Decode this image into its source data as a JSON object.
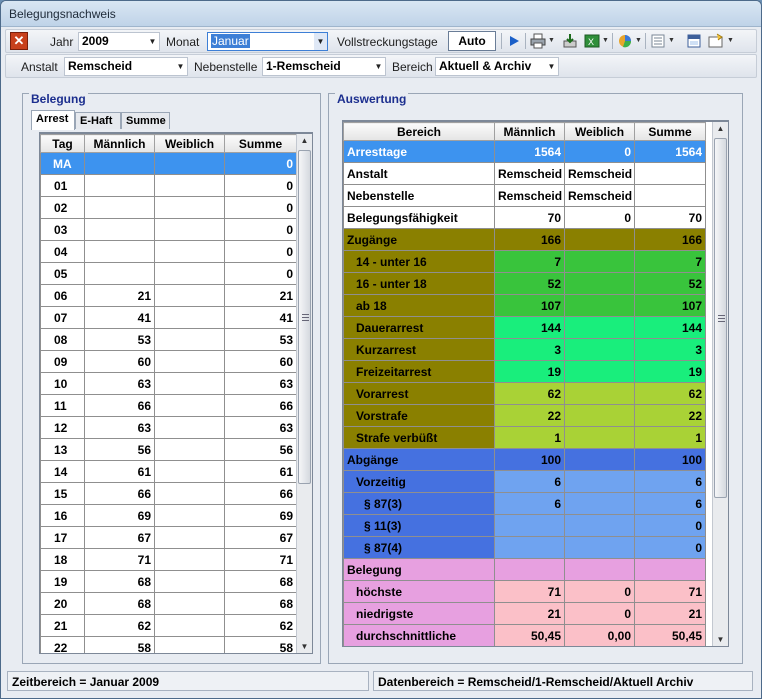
{
  "window": {
    "title": "Belegungsnachweis"
  },
  "toolbar": {
    "jahr_label": "Jahr",
    "jahr_value": "2009",
    "monat_label": "Monat",
    "monat_value": "Januar",
    "vollstreckung_label": "Vollstreckungstage",
    "auto_label": "Auto",
    "anstalt_label": "Anstalt",
    "anstalt_value": "Remscheid",
    "nebenstelle_label": "Nebenstelle",
    "nebenstelle_value": "1-Remscheid",
    "bereich_label": "Bereich",
    "bereich_value": "Aktuell & Archiv"
  },
  "icons": [
    "close-icon",
    "play-icon",
    "print-icon",
    "export-icon",
    "excel-icon",
    "chart-icon",
    "list-icon",
    "preview-icon",
    "settings-icon"
  ],
  "belegung": {
    "title": "Belegung",
    "tabs": [
      "Arrest",
      "E-Haft",
      "Summe"
    ],
    "columns": [
      "Tag",
      "Männlich",
      "Weiblich",
      "Summe"
    ],
    "rows": [
      [
        "MA",
        "",
        "",
        "0"
      ],
      [
        "01",
        "",
        "",
        "0"
      ],
      [
        "02",
        "",
        "",
        "0"
      ],
      [
        "03",
        "",
        "",
        "0"
      ],
      [
        "04",
        "",
        "",
        "0"
      ],
      [
        "05",
        "",
        "",
        "0"
      ],
      [
        "06",
        "21",
        "",
        "21"
      ],
      [
        "07",
        "41",
        "",
        "41"
      ],
      [
        "08",
        "53",
        "",
        "53"
      ],
      [
        "09",
        "60",
        "",
        "60"
      ],
      [
        "10",
        "63",
        "",
        "63"
      ],
      [
        "11",
        "66",
        "",
        "66"
      ],
      [
        "12",
        "63",
        "",
        "63"
      ],
      [
        "13",
        "56",
        "",
        "56"
      ],
      [
        "14",
        "61",
        "",
        "61"
      ],
      [
        "15",
        "66",
        "",
        "66"
      ],
      [
        "16",
        "69",
        "",
        "69"
      ],
      [
        "17",
        "67",
        "",
        "67"
      ],
      [
        "18",
        "71",
        "",
        "71"
      ],
      [
        "19",
        "68",
        "",
        "68"
      ],
      [
        "20",
        "68",
        "",
        "68"
      ],
      [
        "21",
        "62",
        "",
        "62"
      ],
      [
        "22",
        "58",
        "",
        "58"
      ]
    ]
  },
  "auswertung": {
    "title": "Auswertung",
    "columns": [
      "Bereich",
      "Männlich",
      "Weiblich",
      "Summe"
    ],
    "rows": [
      {
        "style": "hl",
        "indent": 0,
        "cells": [
          "Arresttage",
          "1564",
          "0",
          "1564"
        ]
      },
      {
        "style": "white",
        "indent": 0,
        "cells": [
          "Anstalt",
          "Remscheid",
          "Remscheid",
          ""
        ]
      },
      {
        "style": "white",
        "indent": 0,
        "cells": [
          "Nebenstelle",
          "Remscheid",
          "Remscheid",
          ""
        ]
      },
      {
        "style": "white",
        "indent": 0,
        "cells": [
          "Belegungsfähigkeit",
          "70",
          "0",
          "70"
        ]
      },
      {
        "style": "olive",
        "indent": 0,
        "cells": [
          "Zugänge",
          "166",
          "",
          "166"
        ]
      },
      {
        "style": "g1",
        "indent": 1,
        "cells": [
          "14 - unter 16",
          "7",
          "",
          "7"
        ]
      },
      {
        "style": "g1",
        "indent": 1,
        "cells": [
          "16 - unter 18",
          "52",
          "",
          "52"
        ]
      },
      {
        "style": "g1",
        "indent": 1,
        "cells": [
          "ab 18",
          "107",
          "",
          "107"
        ]
      },
      {
        "style": "g2",
        "indent": 1,
        "cells": [
          "Dauerarrest",
          "144",
          "",
          "144"
        ]
      },
      {
        "style": "g2",
        "indent": 1,
        "cells": [
          "Kurzarrest",
          "3",
          "",
          "3"
        ]
      },
      {
        "style": "g2",
        "indent": 1,
        "cells": [
          "Freizeitarrest",
          "19",
          "",
          "19"
        ]
      },
      {
        "style": "g3",
        "indent": 1,
        "cells": [
          "Vorarrest",
          "62",
          "",
          "62"
        ]
      },
      {
        "style": "g3",
        "indent": 1,
        "cells": [
          "Vorstrafe",
          "22",
          "",
          "22"
        ]
      },
      {
        "style": "g3",
        "indent": 1,
        "cells": [
          "Strafe verbüßt",
          "1",
          "",
          "1"
        ]
      },
      {
        "style": "blue",
        "indent": 0,
        "cells": [
          "Abgänge",
          "100",
          "",
          "100"
        ]
      },
      {
        "style": "b1",
        "indent": 1,
        "cells": [
          "Vorzeitig",
          "6",
          "",
          "6"
        ]
      },
      {
        "style": "b2",
        "indent": 2,
        "cells": [
          "§ 87(3)",
          "6",
          "",
          "6"
        ]
      },
      {
        "style": "b2",
        "indent": 2,
        "cells": [
          "§ 11(3)",
          "",
          "",
          "0"
        ]
      },
      {
        "style": "b2",
        "indent": 2,
        "cells": [
          "§ 87(4)",
          "",
          "",
          "0"
        ]
      },
      {
        "style": "pink",
        "indent": 0,
        "cells": [
          "Belegung",
          "",
          "",
          ""
        ]
      },
      {
        "style": "p1",
        "indent": 1,
        "cells": [
          "höchste",
          "71",
          "0",
          "71"
        ]
      },
      {
        "style": "p1",
        "indent": 1,
        "cells": [
          "niedrigste",
          "21",
          "0",
          "21"
        ]
      },
      {
        "style": "p1",
        "indent": 1,
        "cells": [
          "durchschnittliche",
          "50,45",
          "0,00",
          "50,45"
        ]
      }
    ]
  },
  "status": {
    "left": "Zeitbereich = Januar 2009",
    "right": "Datenbereich = Remscheid/1-Remscheid/Aktuell  Archiv"
  }
}
